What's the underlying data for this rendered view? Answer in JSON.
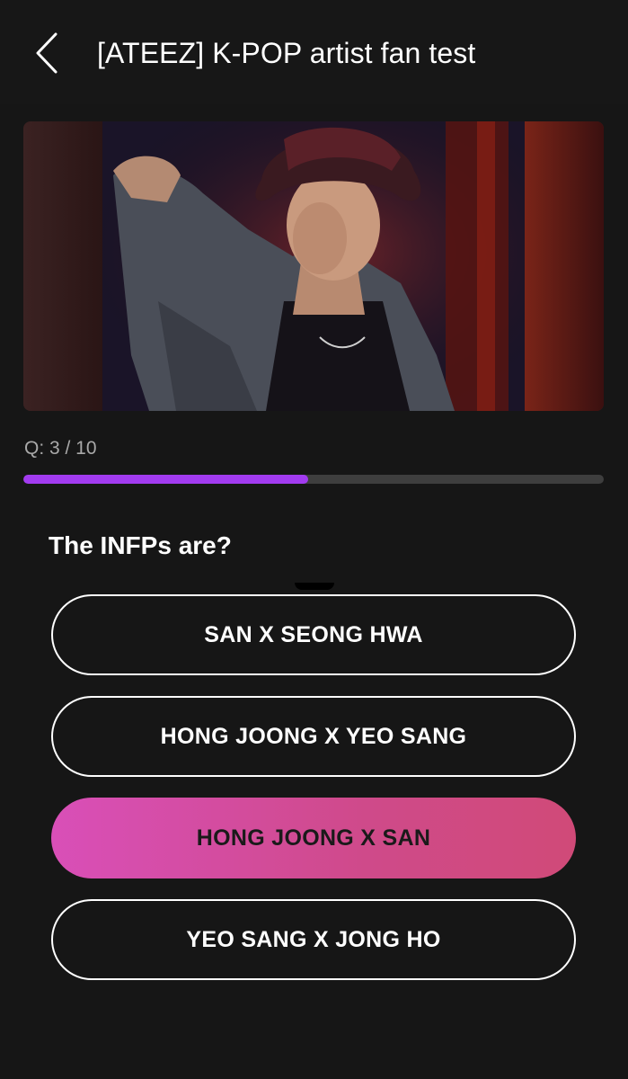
{
  "header": {
    "title": "[ATEEZ] K-POP artist fan test",
    "back_icon": "chevron-left-icon"
  },
  "hero": {
    "alt": "Artist photo"
  },
  "progress": {
    "label": "Q: 3 / 10",
    "current": 3,
    "total": 10,
    "fill_fraction": 0.49,
    "fill_color": "#a23bf0"
  },
  "question": {
    "text": "The INFPs are?"
  },
  "options": [
    {
      "label": "SAN X SEONG HWA",
      "selected": false
    },
    {
      "label": "HONG JOONG X YEO SANG",
      "selected": false
    },
    {
      "label": "HONG JOONG X SAN",
      "selected": true
    },
    {
      "label": "YEO SANG X JONG HO",
      "selected": false
    }
  ],
  "colors": {
    "background": "#161616",
    "selected_gradient_start": "#d94fb8",
    "selected_gradient_end": "#d04a78"
  }
}
